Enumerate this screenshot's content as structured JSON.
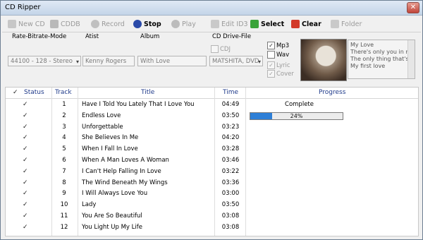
{
  "window": {
    "title": "CD Ripper",
    "close_glyph": "✕"
  },
  "toolbar": {
    "new_cd": {
      "label": "New CD",
      "icon": "new-cd-icon"
    },
    "cddb": {
      "label": "CDDB",
      "icon": "cddb-icon"
    },
    "record": {
      "label": "Record",
      "icon": "record-icon"
    },
    "stop": {
      "label": "Stop",
      "icon": "stop-icon"
    },
    "play": {
      "label": "Play",
      "icon": "play-icon"
    },
    "edit_id3": {
      "label": "Edit ID3",
      "icon": "edit-icon"
    },
    "select": {
      "label": "Select",
      "icon": "select-check-icon"
    },
    "clear": {
      "label": "Clear",
      "icon": "clear-x-icon"
    },
    "folder": {
      "label": "Folder",
      "icon": "folder-icon"
    }
  },
  "options": {
    "mode_label": "Rate-Bitrate-Mode",
    "mode_value": "44100 - 128 - Stereo",
    "artist_label": "Atist",
    "artist_value": "Kenny Rogers",
    "album_label": "Album",
    "album_value": "With Love",
    "drive_label": "CD Drive-File",
    "cdj_label": "CDJ",
    "drive_value": "MATSHITA, DVD",
    "mp3_label": "Mp3",
    "wav_label": "Wav",
    "lyric_label": "Lyric",
    "cover_label": "Cover",
    "check_glyph": "✓",
    "lyrics": [
      "My Love",
      "There's only you in my life",
      "The only thing that's right",
      "My first love"
    ]
  },
  "table": {
    "headers": {
      "status": "Status",
      "track": "Track",
      "title": "Title",
      "time": "Time",
      "progress": "Progress"
    },
    "check_glyph": "✓",
    "rows": [
      {
        "track": "1",
        "title": "Have I Told You Lately That I Love You",
        "time": "04:49",
        "progress": "Complete"
      },
      {
        "track": "2",
        "title": "Endless Love",
        "time": "03:50",
        "progress": "24%",
        "progress_value": 0.24
      },
      {
        "track": "3",
        "title": "Unforgettable",
        "time": "03:23",
        "progress": ""
      },
      {
        "track": "4",
        "title": "She Believes In Me",
        "time": "04:20",
        "progress": ""
      },
      {
        "track": "5",
        "title": "When I Fall In Love",
        "time": "03:28",
        "progress": ""
      },
      {
        "track": "6",
        "title": "When A Man Loves A Woman",
        "time": "03:46",
        "progress": ""
      },
      {
        "track": "7",
        "title": "I Can't Help Falling In Love",
        "time": "03:22",
        "progress": ""
      },
      {
        "track": "8",
        "title": "The Wind Beneath My Wings",
        "time": "03:36",
        "progress": ""
      },
      {
        "track": "9",
        "title": "I Will Always Love You",
        "time": "03:00",
        "progress": ""
      },
      {
        "track": "10",
        "title": "Lady",
        "time": "03:50",
        "progress": ""
      },
      {
        "track": "11",
        "title": "You Are So Beautiful",
        "time": "03:08",
        "progress": ""
      },
      {
        "track": "12",
        "title": "You Light Up My Life",
        "time": "03:08",
        "progress": ""
      }
    ]
  },
  "colors": {
    "progress_fill": "#2d7fd7",
    "header_text": "#1f3a8a"
  }
}
